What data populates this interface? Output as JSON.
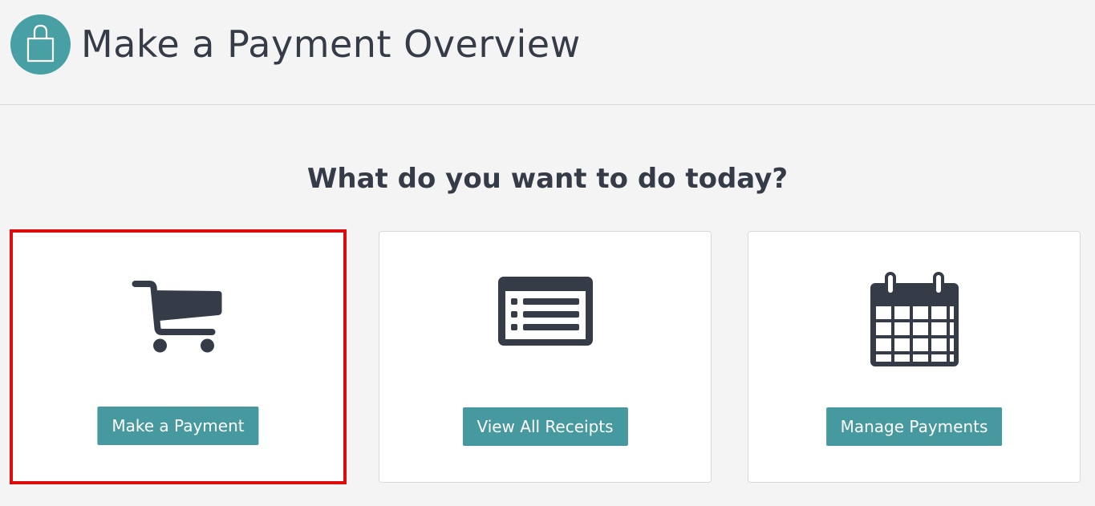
{
  "header": {
    "title": "Make a Payment Overview",
    "icon": "shopping-bag-icon",
    "icon_bg_color": "#48a0a4"
  },
  "main": {
    "prompt": "What do you want to do today?",
    "cards": [
      {
        "icon": "shopping-cart-icon",
        "button_label": "Make a Payment",
        "selected": true
      },
      {
        "icon": "receipt-list-icon",
        "button_label": "View All Receipts",
        "selected": false
      },
      {
        "icon": "calendar-icon",
        "button_label": "Manage Payments",
        "selected": false
      }
    ]
  },
  "colors": {
    "accent": "#46999e",
    "text": "#353c48",
    "selection_border": "#dd0b0b",
    "background": "#f4f4f4"
  }
}
